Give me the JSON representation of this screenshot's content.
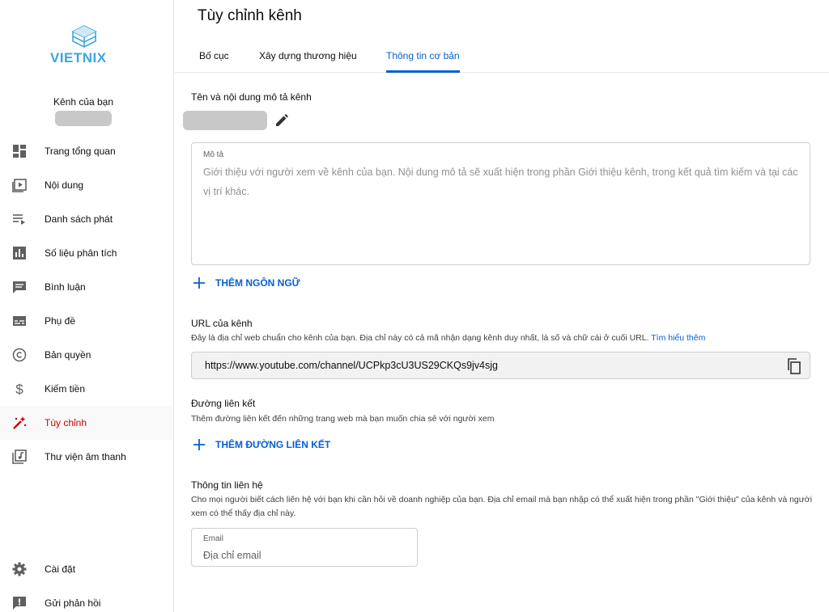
{
  "brand": {
    "logo_text": "VIETNIX",
    "accent": "#3aa6df"
  },
  "sidebar": {
    "channel_label": "Kênh của bạn",
    "items": [
      {
        "label": "Trang tổng quan",
        "icon": "dashboard-icon"
      },
      {
        "label": "Nội dung",
        "icon": "content-icon"
      },
      {
        "label": "Danh sách phát",
        "icon": "playlist-icon"
      },
      {
        "label": "Số liệu phân tích",
        "icon": "analytics-icon"
      },
      {
        "label": "Bình luận",
        "icon": "comments-icon"
      },
      {
        "label": "Phụ đề",
        "icon": "subtitles-icon"
      },
      {
        "label": "Bản quyền",
        "icon": "copyright-icon"
      },
      {
        "label": "Kiếm tiền",
        "icon": "dollar-icon"
      },
      {
        "label": "Tùy chỉnh",
        "icon": "magic-wand-icon",
        "active": true
      },
      {
        "label": "Thư viện âm thanh",
        "icon": "audio-library-icon"
      }
    ],
    "bottom_items": [
      {
        "label": "Cài đặt",
        "icon": "gear-icon"
      },
      {
        "label": "Gửi phản hồi",
        "icon": "feedback-icon"
      }
    ],
    "active_color": "#cc0000"
  },
  "header": {
    "title": "Tùy chỉnh kênh",
    "tabs": [
      {
        "label": "Bố cục"
      },
      {
        "label": "Xây dựng thương hiệu"
      },
      {
        "label": "Thông tin cơ bản",
        "active": true
      }
    ]
  },
  "main": {
    "name_section": {
      "title": "Tên và nội dung mô tả kênh",
      "description_label": "Mô tả",
      "description_placeholder": "Giới thiệu với người xem về kênh của bạn. Nội dung mô tả sẽ xuất hiện trong phần Giới thiệu kênh, trong kết quả tìm kiếm và tại các vị trí khác.",
      "add_language_label": "THÊM NGÔN NGỮ"
    },
    "url_section": {
      "title": "URL của kênh",
      "subtitle": "Đây là địa chỉ web chuẩn cho kênh của bạn. Địa chỉ này có cả mã nhận dạng kênh duy nhất, là số và chữ cái ở cuối URL.",
      "learn_more": "Tìm hiểu thêm",
      "url": "https://www.youtube.com/channel/UCPkp3cU3US29CKQs9jv4sjg"
    },
    "links_section": {
      "title": "Đường liên kết",
      "subtitle": "Thêm đường liên kết đến những trang web mà bạn muốn chia sẻ với người xem",
      "add_link_label": "THÊM ĐƯỜNG LIÊN KẾT"
    },
    "contact_section": {
      "title": "Thông tin liên hệ",
      "subtitle": "Cho mọi người biết cách liên hệ với bạn khi cần hỏi về doanh nghiệp của bạn. Địa chỉ email mà bạn nhập có thể xuất hiện trong phần \"Giới thiệu\" của kênh và người xem có thể thấy địa chỉ này.",
      "email_label": "Email",
      "email_placeholder": "Địa chỉ email"
    },
    "link_color": "#065fd4"
  }
}
